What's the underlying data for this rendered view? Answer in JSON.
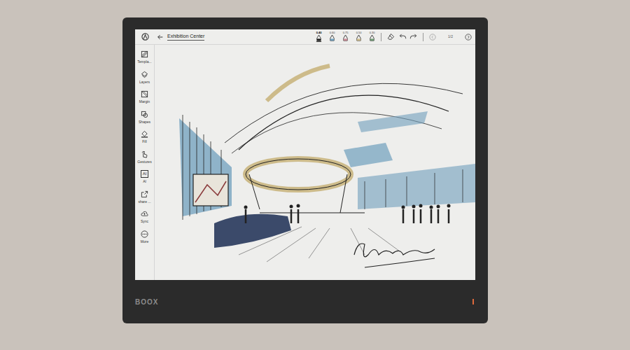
{
  "window": {
    "title": "Exhibition Center"
  },
  "toolbar": {
    "pens": [
      {
        "size": "0.40",
        "color": "#1f1f1f",
        "selected": true
      },
      {
        "size": "0.60",
        "color": "#6f9fbd",
        "selected": false
      },
      {
        "size": "0.75",
        "color": "#c98a95",
        "selected": false
      },
      {
        "size": "0.50",
        "color": "#cdbb8a",
        "selected": false
      },
      {
        "size": "0.30",
        "color": "#6f9b74",
        "selected": false
      }
    ],
    "page": "1/2"
  },
  "sidebar": {
    "items": [
      {
        "label": "Templa...",
        "kind": "icon"
      },
      {
        "label": "Layers",
        "kind": "icon"
      },
      {
        "label": "Margin",
        "kind": "icon"
      },
      {
        "label": "Shapes",
        "kind": "icon"
      },
      {
        "label": "Fill",
        "kind": "icon"
      },
      {
        "label": "Gestures",
        "kind": "icon"
      },
      {
        "label": "AI",
        "kind": "textbox",
        "box_text": "AI"
      },
      {
        "label": "share ...",
        "kind": "icon"
      },
      {
        "label": "Sync",
        "kind": "icon"
      },
      {
        "label": "More",
        "kind": "icon"
      }
    ]
  },
  "device": {
    "brand": "BOOX"
  }
}
